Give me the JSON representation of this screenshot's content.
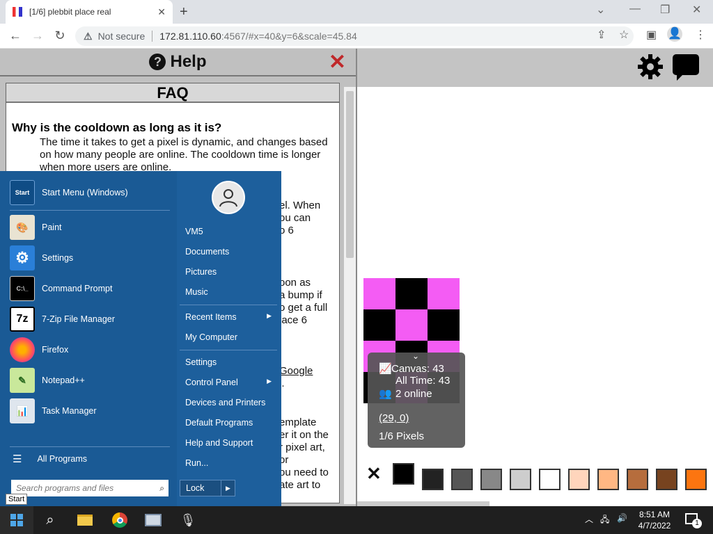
{
  "browser": {
    "tab_title": "[1/6] plebbit place real",
    "tab_close": "✕",
    "new_tab": "+",
    "not_secure": "Not secure",
    "url_host": "172.81.110.60",
    "url_rest": ":4567/#x=40&y=6&scale=45.84"
  },
  "help": {
    "title": "Help",
    "faq_title": "FAQ",
    "question1": "Why is the cooldown as long as it is?",
    "answer1": "The time it takes to get a pixel is dynamic, and changes based on how many people are online. The cooldown time is longer when more users are online.",
    "fragments": [
      "el. When",
      "ou can",
      "o 6",
      "oon as",
      "a bump if",
      "o get a full",
      "lace 6",
      "Google",
      "l.",
      "emplate",
      "er it on the",
      "r pixel art,",
      "or",
      "ou need to",
      "ate art to"
    ]
  },
  "stats": {
    "canvas": "Canvas: 43",
    "all_time": "All Time: 43",
    "online": "2 online",
    "coords": "(29, 0)",
    "pixels": "1/6 Pixels"
  },
  "palette": {
    "close": "✕",
    "colors": [
      "#000000",
      "#222222",
      "#555555",
      "#888888",
      "#cdcdcd",
      "#ffffff",
      "#ffd5bc",
      "#ffb783",
      "#b66d3d",
      "#77431f",
      "#fc7510"
    ]
  },
  "canvas_colors": {
    "pink": "#f45cf4",
    "black": "#000000"
  },
  "startmenu": {
    "pinned": [
      {
        "label": "Start Menu (Windows)",
        "icon": "start-menu-icon"
      },
      {
        "label": "Paint",
        "icon": "paint-icon"
      },
      {
        "label": "Settings",
        "icon": "settings-gear-icon"
      },
      {
        "label": "Command Prompt",
        "icon": "command-prompt-icon"
      },
      {
        "label": "7-Zip File Manager",
        "icon": "7zip-icon"
      },
      {
        "label": "Firefox",
        "icon": "firefox-icon"
      },
      {
        "label": "Notepad++",
        "icon": "notepad-plus-icon"
      },
      {
        "label": "Task Manager",
        "icon": "task-manager-icon"
      }
    ],
    "all_programs": "All Programs",
    "search_placeholder": "Search programs and files",
    "right_items": [
      "VM5",
      "Documents",
      "Pictures",
      "Music",
      "Recent Items",
      "My Computer",
      "Settings",
      "Control Panel",
      "Devices and Printers",
      "Default Programs",
      "Help and Support",
      "Run..."
    ],
    "lock": "Lock",
    "tooltip": "Start"
  },
  "taskbar": {
    "time": "8:51 AM",
    "date": "4/7/2022",
    "notification_count": "1"
  }
}
